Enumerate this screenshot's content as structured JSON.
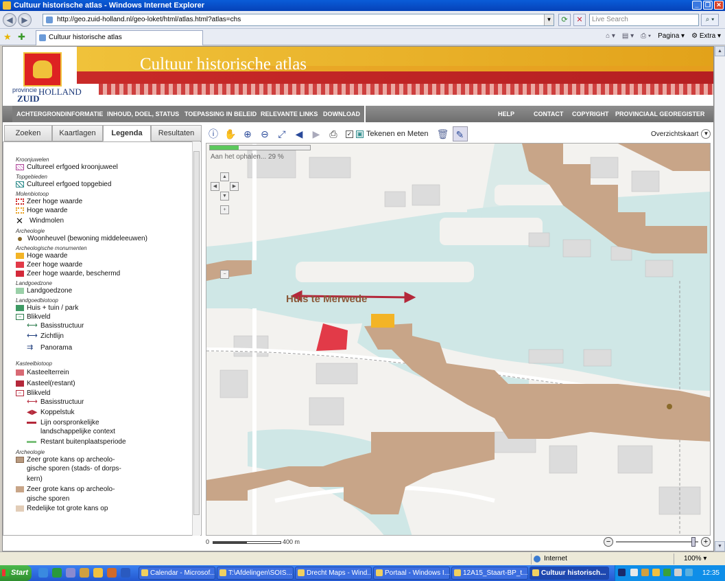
{
  "window": {
    "title": "Cultuur historische atlas - Windows Internet Explorer",
    "url": "http://geo.zuid-holland.nl/geo-loket/html/atlas.html?atlas=chs",
    "search_placeholder": "Live Search",
    "tab_title": "Cultuur historische atlas",
    "cmd_pagina": "Pagina",
    "cmd_extra": "Extra"
  },
  "banner": {
    "title": "Cultuur historische atlas",
    "logo_provincie": "provincie",
    "logo_zuid": "ZUID",
    "logo_holland": "HOLLAND"
  },
  "menu": {
    "left": [
      "ACHTERGRONDINFORMATIE",
      "INHOUD, DOEL, STATUS",
      "TOEPASSING IN BELEID",
      "RELEVANTE LINKS",
      "DOWNLOAD"
    ],
    "right": [
      "HELP",
      "CONTACT",
      "COPYRIGHT",
      "PROVINCIAAL GEOREGISTER"
    ]
  },
  "left_tabs": [
    "Zoeken",
    "Kaartlagen",
    "Legenda",
    "Resultaten"
  ],
  "legend": {
    "kroonjuwelen_head": "Kroonjuwelen",
    "kroonjuweel": "Cultureel erfgoed kroonjuweel",
    "topgebieden_head": "Topgebieden",
    "topgebied": "Cultureel erfgoed topgebied",
    "molen_head": "Molenbiotoop",
    "zeer_hoge": "Zeer hoge waarde",
    "hoge": "Hoge waarde",
    "windmolen": "Windmolen",
    "archeo_head": "Archeologie",
    "woonheuvel": "Woonheuvel (bewoning middeleeuwen)",
    "archeomon_head": "Archeologische monumenten",
    "am_hoge": "Hoge waarde",
    "am_zeer": "Zeer hoge waarde",
    "am_zeer_b": "Zeer hoge waarde, beschermd",
    "landgoedzone_head": "Landgoedzone",
    "landgoedzone": "Landgoedzone",
    "landgoedbiotoop_head": "Landgoedbiotoop",
    "huis_tuin": "Huis + tuin / park",
    "blikveld": "Blikveld",
    "basis": "Basisstructuur",
    "zichtlijn": "Zichtlijn",
    "panorama": "Panorama",
    "kasteel_head": "Kasteelbiotoop",
    "kasteelterrein": "Kasteelterrein",
    "kasteel_restant": "Kasteel(restant)",
    "blikveld2": "Blikveld",
    "basis2": "Basisstructuur",
    "koppelstuk": "Koppelstuk",
    "lijn": "Lijn oorspronkelijke",
    "lijn2": "landschappelijke context",
    "restant": "Restant buitenplaatsperiode",
    "archeo2_head": "Archeologie",
    "zeer_grote1": "Zeer grote kans op archeolo-",
    "zeer_grote1b": "gische sporen (stads- of dorps-",
    "zeer_grote1c": "kern)",
    "zeer_grote2": "Zeer grote kans op archeolo-",
    "zeer_grote2b": "gische sporen",
    "redelijk": "Redelijke tot grote kans op"
  },
  "map": {
    "tekenen": "Tekenen en Meten",
    "overzicht": "Overzichtskaart",
    "progress_text": "Aan het ophalen... 29 %",
    "progress_fraction": 0.29,
    "label": "Huis te Merwede",
    "scale_start": "0",
    "scale_end": "400 m"
  },
  "statusbar": {
    "zone": "Internet",
    "zoom": "100%"
  },
  "taskbar": {
    "start": "Start",
    "items": [
      "Calendar - Microsof...",
      "T:\\Afdelingen\\SOIS...",
      "Drecht Maps - Wind...",
      "Portaal - Windows I...",
      "12A15_Staart-BP_t...",
      "Cultuur historisch..."
    ],
    "clock": "12:35"
  },
  "colors": {
    "archeo_brown": "#c8a588",
    "water": "#cfe7e6",
    "am_hoge": "#f3b426",
    "am_zeer": "#e23a48"
  }
}
